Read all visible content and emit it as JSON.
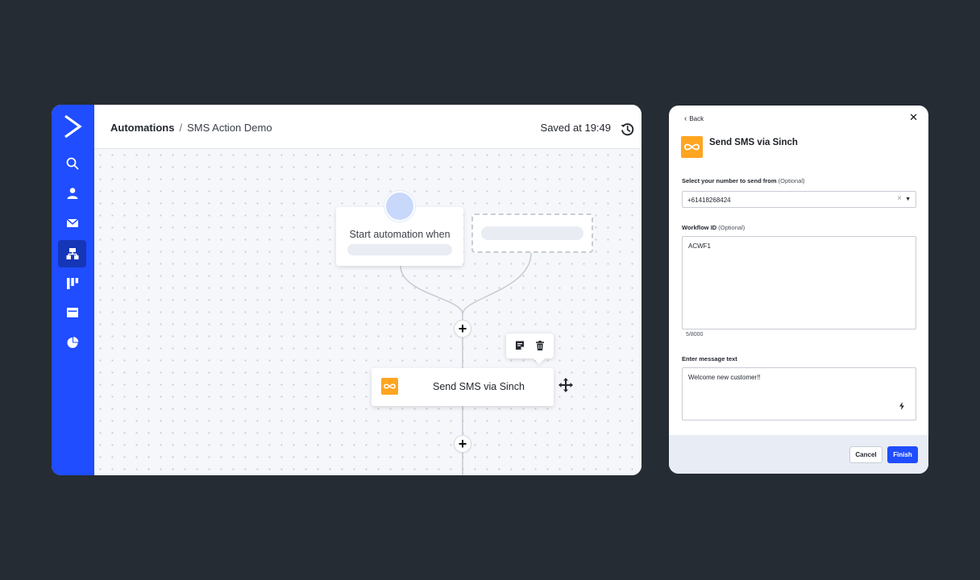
{
  "app": {
    "breadcrumb": {
      "root": "Automations",
      "separator": "/",
      "current": "SMS Action Demo"
    },
    "saved_status": "Saved at 19:49",
    "sidebar": {
      "accent": "#1f4dff",
      "items": [
        {
          "icon": "search-icon"
        },
        {
          "icon": "contacts-icon"
        },
        {
          "icon": "mail-icon"
        },
        {
          "icon": "automations-icon",
          "active": true
        },
        {
          "icon": "pipelines-icon"
        },
        {
          "icon": "website-icon"
        },
        {
          "icon": "reports-icon"
        }
      ]
    },
    "canvas": {
      "trigger_title": "Start automation when",
      "action_title": "Send SMS via Sinch",
      "add_step_label": "+"
    }
  },
  "panel": {
    "back_label": "Back",
    "title": "Send SMS via Sinch",
    "brand_color": "#ffa520",
    "number_field": {
      "label": "Select your number to send from",
      "optional": "(Optional)",
      "value": "+61418268424"
    },
    "workflow_field": {
      "label": "Workflow ID",
      "optional": "(Optional)",
      "value": "ACWF1",
      "counter": "5/8000"
    },
    "message_field": {
      "label": "Enter message text",
      "value": "Welcome new customer!!"
    },
    "cancel_label": "Cancel",
    "finish_label": "Finish"
  }
}
